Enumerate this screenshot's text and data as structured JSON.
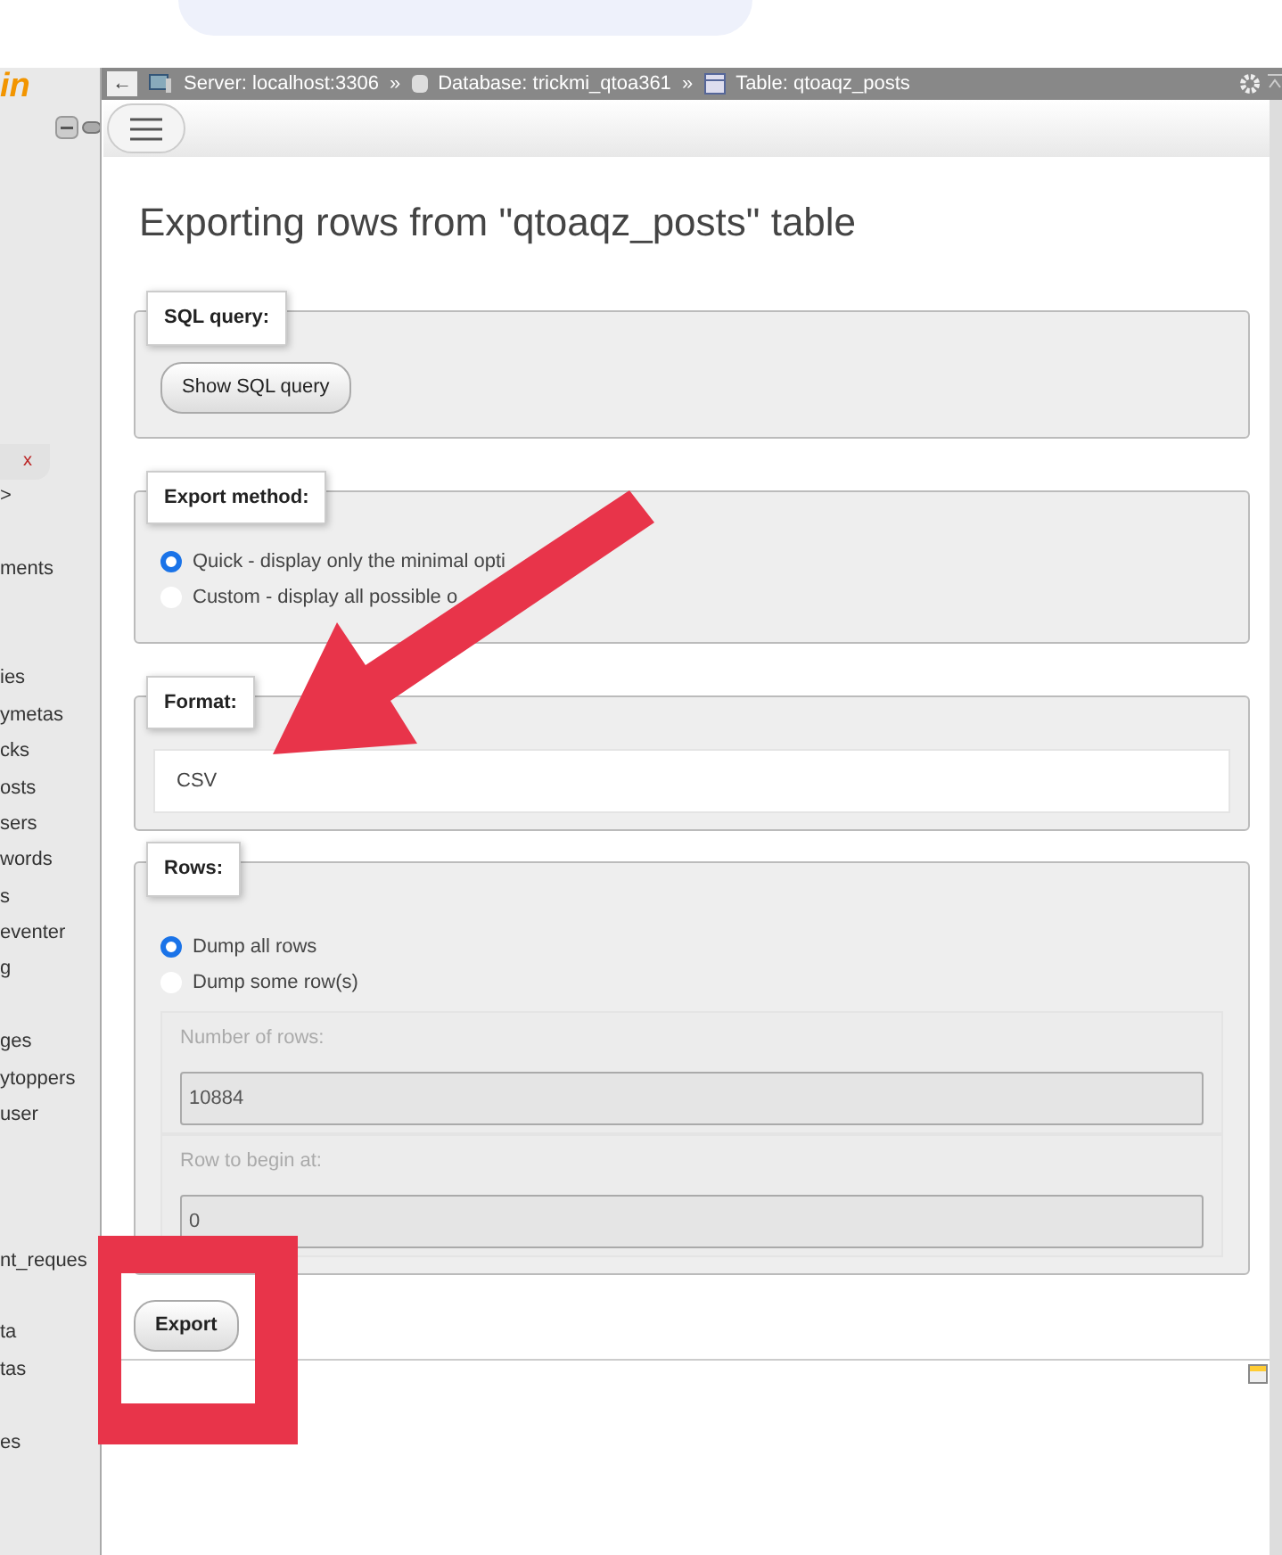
{
  "sidebar": {
    "logo": "in",
    "items": [
      {
        "kind": "tools"
      },
      {
        "kind": "close",
        "text": "x"
      },
      {
        "kind": "text",
        "text": ">"
      },
      {
        "kind": "blank"
      },
      {
        "kind": "text",
        "text": "ments"
      },
      {
        "kind": "blank"
      },
      {
        "kind": "blank"
      },
      {
        "kind": "text",
        "text": "ies"
      },
      {
        "kind": "text",
        "text": "ymetas"
      },
      {
        "kind": "text",
        "text": "cks"
      },
      {
        "kind": "text",
        "text": "osts"
      },
      {
        "kind": "text",
        "text": "sers"
      },
      {
        "kind": "text",
        "text": "words"
      },
      {
        "kind": "text",
        "text": "s"
      },
      {
        "kind": "text",
        "text": "eventer"
      },
      {
        "kind": "text",
        "text": "g"
      },
      {
        "kind": "blank"
      },
      {
        "kind": "text",
        "text": "ges"
      },
      {
        "kind": "text",
        "text": "ytoppers"
      },
      {
        "kind": "text",
        "text": "user"
      },
      {
        "kind": "blank"
      },
      {
        "kind": "blank"
      },
      {
        "kind": "blank"
      },
      {
        "kind": "text",
        "text": "nt_reques"
      },
      {
        "kind": "blank"
      },
      {
        "kind": "text",
        "text": "ta"
      },
      {
        "kind": "text",
        "text": "tas"
      },
      {
        "kind": "blank"
      },
      {
        "kind": "text",
        "text": "es"
      }
    ]
  },
  "breadcrumb": [
    {
      "kind": "back",
      "text": "←"
    },
    {
      "kind": "server",
      "text": "Server: localhost:3306"
    },
    {
      "kind": "separator",
      "text": "»"
    },
    {
      "kind": "database",
      "text": "Database: trickmi_qtoa361"
    },
    {
      "kind": "separator",
      "text": "»"
    },
    {
      "kind": "table",
      "text": "Table: qtoaqz_posts"
    }
  ],
  "title": "Exporting rows from \"qtoaqz_posts\" table",
  "sections": [
    {
      "kind": "button",
      "legend": "SQL query:",
      "button": "Show SQL query"
    },
    {
      "kind": "radios",
      "legend": "Export method:",
      "options": [
        {
          "label": "Quick - display only the minimal opti",
          "selected": true
        },
        {
          "label": "Custom - display all possible o",
          "selected": false
        }
      ]
    },
    {
      "kind": "select",
      "legend": "Format:",
      "value": "CSV"
    },
    {
      "kind": "rows",
      "legend": "Rows:",
      "options": [
        {
          "label": "Dump all rows",
          "selected": true
        },
        {
          "label": "Dump some row(s)",
          "selected": false
        }
      ],
      "fields": [
        {
          "label": "Number of rows:",
          "value": "10884",
          "disabled": true
        },
        {
          "label": "Row to begin at:",
          "value": "0",
          "disabled": true
        }
      ]
    }
  ],
  "export_button": "Export"
}
